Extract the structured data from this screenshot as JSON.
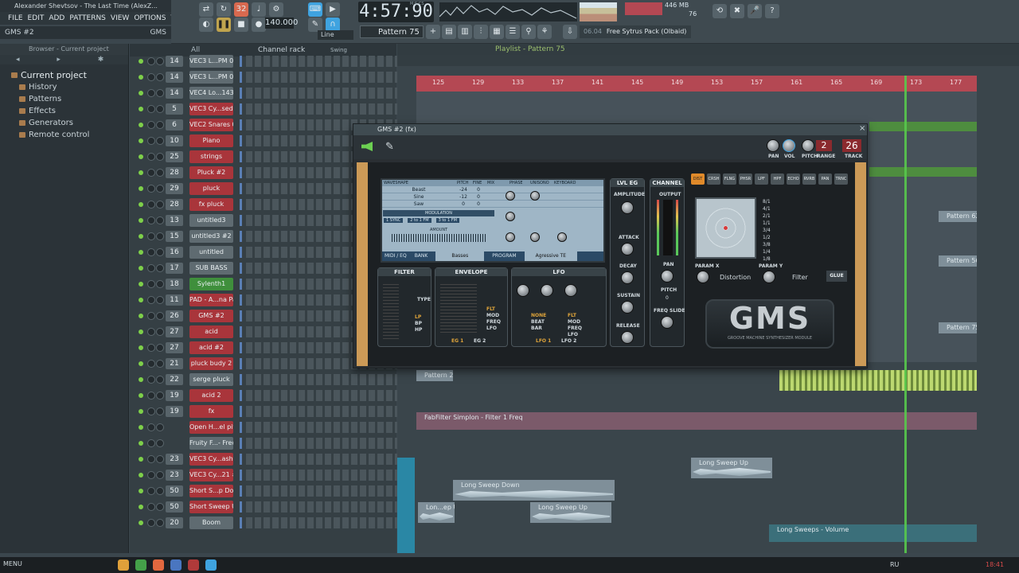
{
  "window": {
    "title": "Alexander Shevtsov - The Last Time (AlexZ..."
  },
  "menu": [
    "FILE",
    "EDIT",
    "ADD",
    "PATTERNS",
    "VIEW",
    "OPTIONS",
    "TOOLS",
    "?"
  ],
  "hint_left": {
    "name": "GMS #2",
    "tag": "GMS"
  },
  "transport": {
    "time": "4:57:90",
    "time_label": "M:S:CS",
    "tempo": "140.000",
    "pattern": "Pattern 75",
    "snap": "Line",
    "pattern_num": "32",
    "cpu_label": "446 MB",
    "cpu_val": "76"
  },
  "hint_right": {
    "version": "06.04",
    "text": "Free Sytrus Pack (Olbaid)"
  },
  "browser": {
    "header": "Browser - Current project",
    "items": [
      "Current project",
      "History",
      "Patterns",
      "Effects",
      "Generators",
      "Remote control"
    ]
  },
  "channel_rack": {
    "filter": "All",
    "title": "Channel rack",
    "swing": "Swing",
    "channels": [
      {
        "num": "14",
        "name": "VEC3 L...PM 094",
        "color": "grey"
      },
      {
        "num": "14",
        "name": "VEC3 L...PM 006",
        "color": "grey"
      },
      {
        "num": "14",
        "name": "VEC4 Lo...143 #2",
        "color": "grey"
      },
      {
        "num": "5",
        "name": "VEC3 Cy...sed 33",
        "color": "red"
      },
      {
        "num": "6",
        "name": "VEC2 Snares 020",
        "color": "red"
      },
      {
        "num": "10",
        "name": "Piano",
        "color": "red"
      },
      {
        "num": "25",
        "name": "strings",
        "color": "red"
      },
      {
        "num": "28",
        "name": "Pluck #2",
        "color": "red"
      },
      {
        "num": "29",
        "name": "pluck",
        "color": "red"
      },
      {
        "num": "28",
        "name": "fx pluck",
        "color": "red"
      },
      {
        "num": "13",
        "name": "untitled3",
        "color": "grey"
      },
      {
        "num": "15",
        "name": "untitled3 #2",
        "color": "grey"
      },
      {
        "num": "16",
        "name": "untitled",
        "color": "grey"
      },
      {
        "num": "17",
        "name": "SUB BASS",
        "color": "grey"
      },
      {
        "num": "18",
        "name": "Sylenth1",
        "color": "green"
      },
      {
        "num": "11",
        "name": "PAD - A...na Pad",
        "color": "red"
      },
      {
        "num": "26",
        "name": "GMS #2",
        "color": "red"
      },
      {
        "num": "27",
        "name": "acid",
        "color": "red"
      },
      {
        "num": "27",
        "name": "acid #2",
        "color": "red"
      },
      {
        "num": "21",
        "name": "pluck budy 2",
        "color": "red"
      },
      {
        "num": "22",
        "name": "serge pluck",
        "color": "grey"
      },
      {
        "num": "19",
        "name": "acid 2",
        "color": "red"
      },
      {
        "num": "19",
        "name": "fx",
        "color": "red"
      },
      {
        "num": "",
        "name": "Open H...el pitch",
        "color": "red"
      },
      {
        "num": "",
        "name": "Fruity F...- Freq",
        "color": "grey"
      },
      {
        "num": "23",
        "name": "VEC3 Cy...ash 21",
        "color": "red"
      },
      {
        "num": "23",
        "name": "VEC3 Cy...21 #2",
        "color": "red"
      },
      {
        "num": "50",
        "name": "Short S...p Down",
        "color": "red"
      },
      {
        "num": "50",
        "name": "Short Sweep Up",
        "color": "red"
      },
      {
        "num": "20",
        "name": "Boom",
        "color": "grey"
      }
    ]
  },
  "playlist": {
    "title": "Playlist - Pattern 75",
    "ruler": [
      "125",
      "129",
      "133",
      "137",
      "141",
      "145",
      "149",
      "153",
      "157",
      "161",
      "165",
      "169",
      "173",
      "177"
    ],
    "clips": {
      "p62": "Pattern 62",
      "p56": "Pattern 56",
      "p75": "Pattern 75",
      "p25": "Pattern 25",
      "automation": "FabFilter Simplon - Filter 1 Freq",
      "sweep_up1": "Long Sweep Up",
      "sweep_down": "Long Sweep Down",
      "sweep_up2": "Long Sweep Up",
      "lon_ep": "Lon...ep Up",
      "sweeps_vol": "Long Sweeps - Volume"
    }
  },
  "plugin": {
    "title": "GMS #2 (fx)",
    "pan_label": "PAN",
    "vol_label": "VOL",
    "pitch_label": "PITCH",
    "range_label": "RANGE",
    "range_val": "2",
    "track_label": "TRACK",
    "track_val": "26",
    "oscillators": [
      {
        "wave": "Beast",
        "pitch": "-24",
        "fine": "0"
      },
      {
        "wave": "Sine",
        "pitch": "-12",
        "fine": "0"
      },
      {
        "wave": "Saw",
        "pitch": "0",
        "fine": "0"
      }
    ],
    "lcd_headers": [
      "WAVESHAPE",
      "PITCH",
      "FINE",
      "MIX",
      "PHASE",
      "UNISONO",
      "KEYBOARD"
    ],
    "modulation_label": "MODULATION",
    "mod_options": [
      "1 SYNC",
      "2 to 1 FM",
      "3 to 1 FM"
    ],
    "amount_label": "AMOUNT",
    "midi_eq": "MIDI / EQ",
    "bank_label": "BANK",
    "bank_val": "Basses",
    "program_label": "PROGRAM",
    "program_val": "Agressive TE",
    "lvl_eg": "LVL EG",
    "channel": "CHANNEL",
    "amplitude": "AMPLITUDE",
    "attack": "ATTACK",
    "decay": "DECAY",
    "sustain": "SUSTAIN",
    "release": "RELEASE",
    "output": "OUTPUT",
    "pan": "PAN",
    "pitch": "PITCH",
    "pitch_val": "0",
    "freq_slide": "FREQ SLIDE",
    "filter": "FILTER",
    "envelope": "ENVELOPE",
    "lfo": "LFO",
    "filter_type": "TYPE",
    "filter_modes": [
      "LP",
      "BP",
      "HP"
    ],
    "eg_labels": [
      "EG 1",
      "EG 2"
    ],
    "lfo_labels": [
      "LFO 1",
      "LFO 2"
    ],
    "lfo_sync": [
      "NONE",
      "BEAT",
      "BAR"
    ],
    "dest": [
      "FLT",
      "MOD",
      "FREQ",
      "LFO"
    ],
    "fx_tabs": [
      "DIST",
      "CRSH",
      "FLNG",
      "PHSR",
      "LPF",
      "HPF",
      "ECHO",
      "RVRB",
      "PAN",
      "TRNC"
    ],
    "rates": [
      "8/1",
      "4/1",
      "2/1",
      "1/1",
      "3/4",
      "1/2",
      "3/8",
      "1/4",
      "1/8"
    ],
    "param_x": "PARAM X",
    "param_y": "PARAM Y",
    "fx_x_val": "Distortion",
    "fx_y_val": "Filter",
    "glue": "GLUE",
    "logo": "GMS",
    "logo_sub": "GROOVE MACHINE SYNTHESIZER MODULE"
  },
  "taskbar": {
    "start": "MENU",
    "lang": "RU",
    "clock": "18:41"
  }
}
